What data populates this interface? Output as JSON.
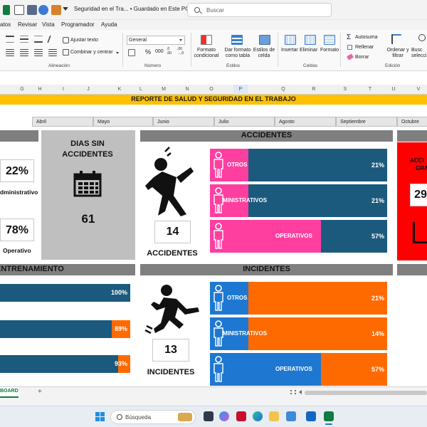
{
  "window": {
    "title": "Seguridad en el Tra... • Guardado en Este PC",
    "search_placeholder": "Buscar"
  },
  "menu": [
    "atos",
    "Revisar",
    "Vista",
    "Programador",
    "Ayuda"
  ],
  "ribbon": {
    "wrap_text": "Ajustar texto",
    "merge_center": "Combinar y centrar",
    "number_format": "General",
    "percent": "%",
    "thousands": "000",
    "dec_inc": ",0 .00",
    "dec_dec": ",00 →,0",
    "cond_format": "Formato condicional",
    "format_table": "Dar formato como tabla",
    "cell_styles": "Estilos de celda",
    "insert": "Insertar",
    "delete": "Eliminar",
    "format": "Formato",
    "autosum": "Autosuma",
    "fill": "Rellenar",
    "clear": "Borrar",
    "sort_filter": "Ordenar y filtrar",
    "find_select": "Busc selecci",
    "groups": {
      "alignment": "Alineación",
      "number": "Número",
      "styles": "Estilos",
      "cells": "Celdas",
      "editing": "Edición"
    }
  },
  "columns": [
    "G",
    "H",
    "I",
    "J",
    "K",
    "L",
    "M",
    "N",
    "O",
    "P",
    "Q",
    "R",
    "S",
    "T",
    "U",
    "V"
  ],
  "selected_column": "P",
  "report_title": "REPORTE DE SALUD Y SEGURIDAD EN EL TRABAJO",
  "months": [
    "Abril",
    "Mayo",
    "Junio",
    "Julio",
    "Agosto",
    "Septiembre",
    "Octubre"
  ],
  "left_panel": {
    "admin_pct": "22%",
    "admin_label": "dministrativo",
    "oper_pct": "78%",
    "oper_label": "Operativo"
  },
  "dias": {
    "title": "DIAS SIN ACCIDENTES",
    "value": "61",
    "icon": "calendar-icon"
  },
  "accidentes": {
    "header": "ACCIDENTES",
    "count": "14",
    "label": "ACCIDENTES",
    "rows": [
      {
        "label": "OTROS",
        "pct": "21%",
        "value": 0.21
      },
      {
        "label": "MINISTRATIVOS",
        "pct": "21%",
        "value": 0.21
      },
      {
        "label": "OPERATIVOS",
        "pct": "57%",
        "value": 0.57
      }
    ],
    "fill_color": "#ff3fa0",
    "rest_color": "#1b5a7d"
  },
  "incidentes": {
    "header": "INCIDENTES",
    "count": "13",
    "label": "INCIDENTES",
    "rows": [
      {
        "label": "OTROS",
        "pct": "21%",
        "value": 0.21
      },
      {
        "label": "MINISTRATIVOS",
        "pct": "14%",
        "value": 0.14
      },
      {
        "label": "OPERATIVOS",
        "pct": "57%",
        "value": 0.57
      }
    ],
    "fill_color": "#1e78d2",
    "rest_color": "#ff6a00"
  },
  "entrenamiento": {
    "header": "ENTRENAMIENTO",
    "rows": [
      {
        "pct": "100%",
        "value": 1.0
      },
      {
        "pct": "89%",
        "value": 0.89
      },
      {
        "pct": "93%",
        "value": 0.93
      }
    ],
    "fill_color": "#1b5a7d",
    "rest_color": "#ff6a00"
  },
  "red_panel": {
    "line1": "ACCI",
    "line2": "GRA",
    "value": "29"
  },
  "sheet_tab": "BOARD",
  "taskbar": {
    "search": "Búsqueda"
  }
}
